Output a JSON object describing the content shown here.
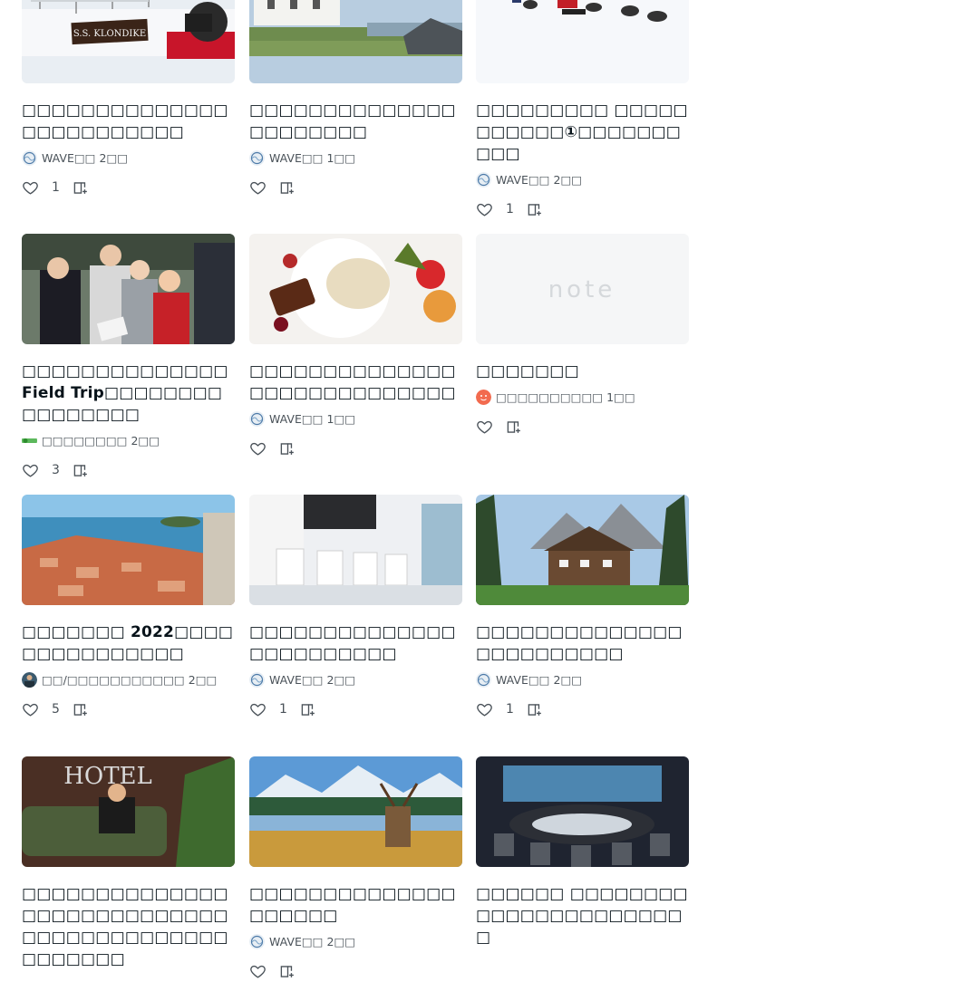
{
  "cards": [
    {
      "title": "□□□□□□□□□□□□□□□□□□□□□□□□□",
      "author": "WAVE□□",
      "time": "2□□",
      "likes": "1",
      "thumb": "snow-klondike",
      "sign": "S.S. KLONDIKE",
      "avatar": "wave"
    },
    {
      "title": "□□□□□□□□□□□□□□□□□□□□□□",
      "author": "WAVE□□",
      "time": "1□□",
      "likes": "",
      "thumb": "ireland",
      "avatar": "wave"
    },
    {
      "title": "□□□□□□□□□ □□□□□□□□□□□①□□□□□□□□□□",
      "author": "WAVE□□",
      "time": "2□□",
      "likes": "1",
      "thumb": "dogsled",
      "avatar": "wave"
    },
    {
      "title": "□□□□□□□□□□□□□□Field Trip□□□□□□□□□□□□□□□□",
      "author": "□□□□□□□□",
      "time": "2□□",
      "likes": "3",
      "thumb": "students",
      "avatar": "green"
    },
    {
      "title": "□□□□□□□□□□□□□□□□□□□□□□□□□□□□",
      "author": "WAVE□□",
      "time": "1□□",
      "likes": "",
      "thumb": "food",
      "avatar": "wave"
    },
    {
      "title": "□□□□□□□",
      "author": "□□□□□□□□□□",
      "time": "1□□",
      "likes": "",
      "thumb": "note",
      "note_text": "note",
      "avatar": "orange"
    },
    {
      "title": "□□□□□□□ 2022□□□□□□□□□□□□□□□",
      "author": "□□/□□□□□□□□□□□",
      "time": "2□□",
      "likes": "5",
      "thumb": "dubrovnik",
      "avatar": "photo"
    },
    {
      "title": "□□□□□□□□□□□□□□□□□□□□□□□□",
      "author": "WAVE□□",
      "time": "2□□",
      "likes": "1",
      "thumb": "salon",
      "avatar": "wave"
    },
    {
      "title": "□□□□□□□□□□□□□□□□□□□□□□□□",
      "author": "WAVE□□",
      "time": "2□□",
      "likes": "1",
      "thumb": "lodge",
      "avatar": "wave"
    },
    {
      "title": "□□□□□□□□□□□□□□□□□□□□□□□□□□□□□□□□□□□□□□□□□□□□□□□□□",
      "author": "",
      "time": "",
      "likes": "",
      "thumb": "hotel",
      "sign": "HOTEL",
      "avatar": ""
    },
    {
      "title": "□□□□□□□□□□□□□□□□□□□□",
      "author": "WAVE□□",
      "time": "2□□",
      "likes": "",
      "thumb": "elk",
      "avatar": "wave"
    },
    {
      "title": "□□□□□□ □□□□□□□□□□□□□□□□□□□□□□□",
      "author": "",
      "time": "",
      "likes": "",
      "thumb": "restaurant",
      "avatar": ""
    }
  ],
  "icons": {
    "like": "heart-outline-icon",
    "save": "magazine-add-icon"
  },
  "colors": {
    "text": "#08131a",
    "meta": "#4a5259",
    "background": "#ffffff"
  }
}
